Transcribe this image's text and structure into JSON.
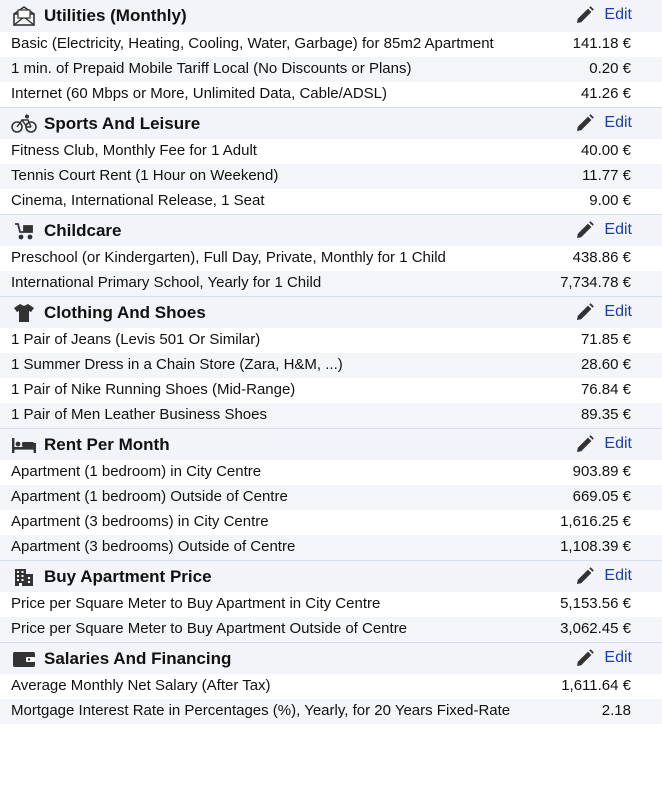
{
  "edit_label": "Edit",
  "colors": {
    "header_bg": "#f2f4f9",
    "alt_row_bg": "#f4f5f8",
    "link": "#1d3fa3"
  },
  "sections": [
    {
      "title": "Utilities (Monthly)",
      "icon": "envelope-icon",
      "rows": [
        {
          "label": "Basic (Electricity, Heating, Cooling, Water, Garbage) for 85m2 Apartment",
          "value": "141.18 €"
        },
        {
          "label": "1 min. of Prepaid Mobile Tariff Local (No Discounts or Plans)",
          "value": "0.20 €"
        },
        {
          "label": "Internet (60 Mbps or More, Unlimited Data, Cable/ADSL)",
          "value": "41.26 €"
        }
      ]
    },
    {
      "title": "Sports And Leisure",
      "icon": "bicycle-icon",
      "rows": [
        {
          "label": "Fitness Club, Monthly Fee for 1 Adult",
          "value": "40.00 €"
        },
        {
          "label": "Tennis Court Rent (1 Hour on Weekend)",
          "value": "11.77 €"
        },
        {
          "label": "Cinema, International Release, 1 Seat",
          "value": "9.00 €"
        }
      ]
    },
    {
      "title": "Childcare",
      "icon": "stroller-icon",
      "rows": [
        {
          "label": "Preschool (or Kindergarten), Full Day, Private, Monthly for 1 Child",
          "value": "438.86 €"
        },
        {
          "label": "International Primary School, Yearly for 1 Child",
          "value": "7,734.78 €"
        }
      ]
    },
    {
      "title": "Clothing And Shoes",
      "icon": "tshirt-icon",
      "rows": [
        {
          "label": "1 Pair of Jeans (Levis 501 Or Similar)",
          "value": "71.85 €"
        },
        {
          "label": "1 Summer Dress in a Chain Store (Zara, H&M, ...)",
          "value": "28.60 €"
        },
        {
          "label": "1 Pair of Nike Running Shoes (Mid-Range)",
          "value": "76.84 €"
        },
        {
          "label": "1 Pair of Men Leather Business Shoes",
          "value": "89.35 €"
        }
      ]
    },
    {
      "title": "Rent Per Month",
      "icon": "bed-icon",
      "rows": [
        {
          "label": "Apartment (1 bedroom) in City Centre",
          "value": "903.89 €"
        },
        {
          "label": "Apartment (1 bedroom) Outside of Centre",
          "value": "669.05 €"
        },
        {
          "label": "Apartment (3 bedrooms) in City Centre",
          "value": "1,616.25 €"
        },
        {
          "label": "Apartment (3 bedrooms) Outside of Centre",
          "value": "1,108.39 €"
        }
      ]
    },
    {
      "title": "Buy Apartment Price",
      "icon": "building-icon",
      "rows": [
        {
          "label": "Price per Square Meter to Buy Apartment in City Centre",
          "value": "5,153.56 €"
        },
        {
          "label": "Price per Square Meter to Buy Apartment Outside of Centre",
          "value": "3,062.45 €"
        }
      ]
    },
    {
      "title": "Salaries And Financing",
      "icon": "wallet-icon",
      "rows": [
        {
          "label": "Average Monthly Net Salary (After Tax)",
          "value": "1,611.64 €"
        },
        {
          "label": "Mortgage Interest Rate in Percentages (%), Yearly, for 20 Years Fixed-Rate",
          "value": "2.18"
        }
      ]
    }
  ]
}
